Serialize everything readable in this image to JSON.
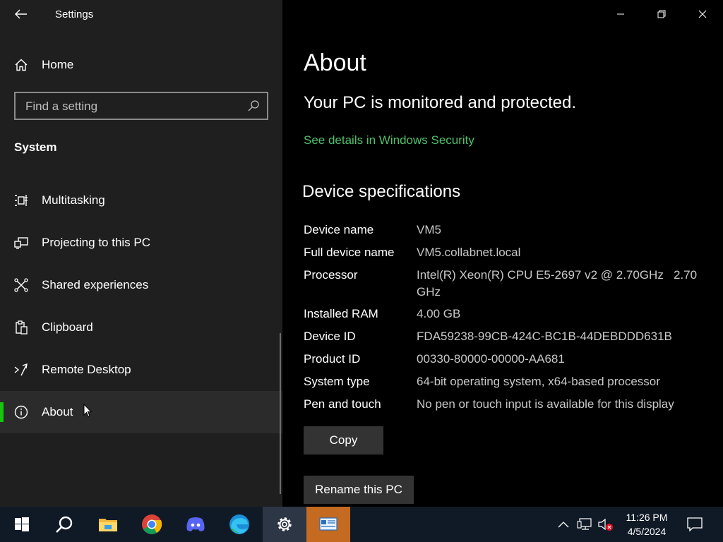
{
  "window": {
    "title": "Settings"
  },
  "sidebar": {
    "home_label": "Home",
    "search_placeholder": "Find a setting",
    "section": "System",
    "items": [
      {
        "label": "Multitasking",
        "icon": "multitasking-icon"
      },
      {
        "label": "Projecting to this PC",
        "icon": "projecting-icon"
      },
      {
        "label": "Shared experiences",
        "icon": "shared-experiences-icon"
      },
      {
        "label": "Clipboard",
        "icon": "clipboard-icon"
      },
      {
        "label": "Remote Desktop",
        "icon": "remote-desktop-icon"
      },
      {
        "label": "About",
        "icon": "info-icon",
        "selected": true
      }
    ]
  },
  "main": {
    "title": "About",
    "protection_status": "Your PC is monitored and protected.",
    "security_link": "See details in Windows Security",
    "specs_heading": "Device specifications",
    "specs": [
      {
        "key": "Device name",
        "value": "VM5"
      },
      {
        "key": "Full device name",
        "value": "VM5.collabnet.local"
      },
      {
        "key": "Processor",
        "value": "Intel(R) Xeon(R) CPU E5-2697 v2 @ 2.70GHz   2.70 GHz"
      },
      {
        "key": "Installed RAM",
        "value": "4.00 GB"
      },
      {
        "key": "Device ID",
        "value": "FDA59238-99CB-424C-BC1B-44DEBDDD631B"
      },
      {
        "key": "Product ID",
        "value": "00330-80000-00000-AA681"
      },
      {
        "key": "System type",
        "value": "64-bit operating system, x64-based processor"
      },
      {
        "key": "Pen and touch",
        "value": "No pen or touch input is available for this display"
      }
    ],
    "copy_button": "Copy",
    "rename_button": "Rename this PC"
  },
  "taskbar": {
    "time": "11:26 PM",
    "date": "4/5/2024",
    "apps": [
      "start-icon",
      "search-icon",
      "file-explorer-icon",
      "chrome-icon",
      "discord-icon",
      "edge-icon",
      "settings-icon",
      "system-info-icon"
    ]
  },
  "colors": {
    "accent_green": "#16c60c",
    "link_green": "#4fc16b",
    "sidebar_bg": "#1f1f1f",
    "main_bg": "#000000",
    "taskbar_bg": "#101a27"
  }
}
